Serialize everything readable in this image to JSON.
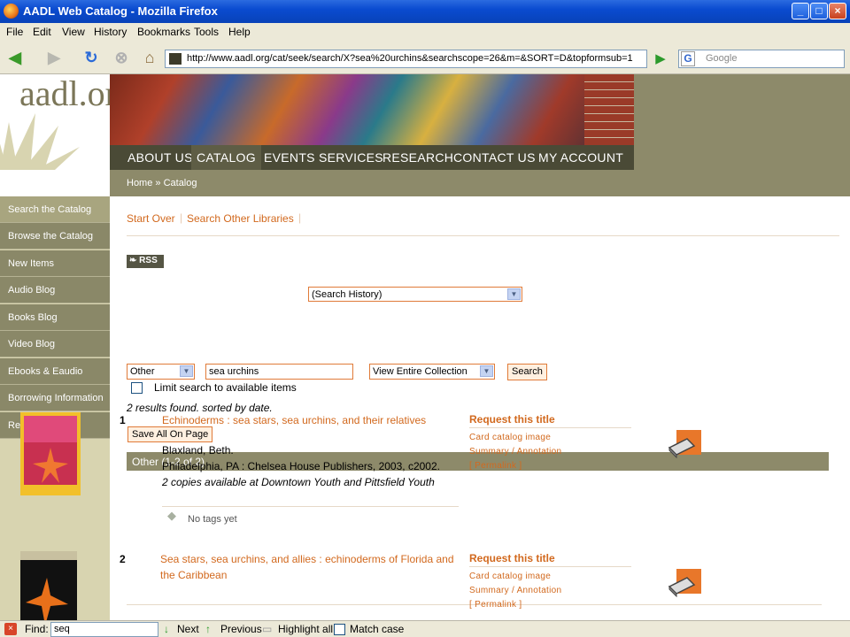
{
  "window": {
    "title": "AADL Web Catalog - Mozilla Firefox"
  },
  "menu": [
    "File",
    "Edit",
    "View",
    "History",
    "Bookmarks",
    "Tools",
    "Help"
  ],
  "toolbar": {
    "url": "http://www.aadl.org/cat/seek/search/X?sea%20urchins&searchscope=26&m=&SORT=D&topformsub=1",
    "search_placeholder": "Google"
  },
  "site": {
    "logo": "aadl.org",
    "nav": [
      "ABOUT US",
      "CATALOG",
      "EVENTS",
      "SERVICES",
      "RESEARCH",
      "CONTACT US",
      "MY ACCOUNT"
    ],
    "breadcrumb": "Home » Catalog"
  },
  "sidebar": [
    "Search the Catalog",
    "Browse the Catalog",
    "New Items",
    "Audio Blog",
    "Books Blog",
    "Video Blog",
    "Ebooks & Eaudio",
    "Borrowing Information",
    "Request ILL"
  ],
  "catalog": {
    "start_over": "Start Over",
    "search_other": "Search Other Libraries",
    "search_history": "(Search History)",
    "rss": "RSS",
    "search_type": "Other",
    "search_term": "sea urchins",
    "scope": "View Entire Collection",
    "search_button": "Search",
    "limit_label": "Limit search to available items",
    "results_summary": "2 results found. sorted by date.",
    "save_all": "Save All On Page",
    "results_header": "Other (1-2 of 2)"
  },
  "results": [
    {
      "num": "1",
      "title": "Echinoderms : sea stars, sea urchins, and their relatives",
      "author": "Blaxland, Beth.",
      "publisher": "Philadelphia, PA : Chelsea House Publishers, 2003, c2002.",
      "availability": "2 copies available at Downtown Youth and Pittsfield Youth",
      "tags": "No tags yet",
      "request": "Request this title",
      "card": "Card catalog image",
      "summary": "Summary / Annotation",
      "permalink": "[ Permalink ]"
    },
    {
      "num": "2",
      "title": "Sea stars, sea urchins, and allies : echinoderms of Florida and the Caribbean",
      "request": "Request this title",
      "card": "Card catalog image",
      "summary": "Summary / Annotation",
      "permalink": "[ Permalink ]"
    }
  ],
  "findbar": {
    "label": "Find:",
    "value": "seq",
    "next": "Next",
    "previous": "Previous",
    "highlight": "Highlight all",
    "match_case": "Match case"
  }
}
